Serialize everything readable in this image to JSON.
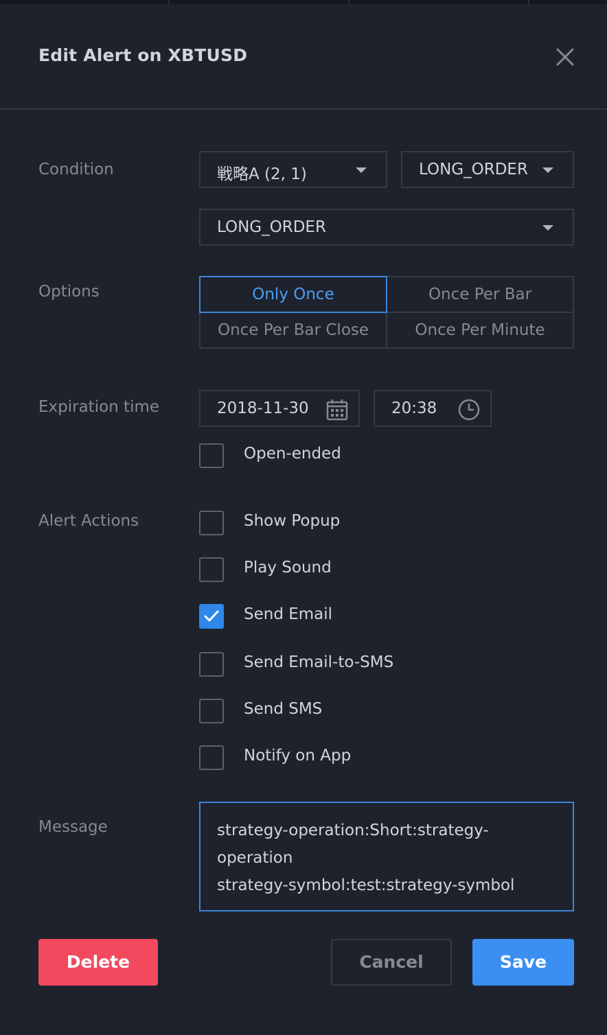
{
  "dialog": {
    "title": "Edit Alert on XBTUSD",
    "close_icon": "close-icon"
  },
  "condition": {
    "label": "Condition",
    "source": "戦略A (2, 1)",
    "field": "LONG_ORDER",
    "value": "LONG_ORDER"
  },
  "options": {
    "label": "Options",
    "items": [
      "Only Once",
      "Once Per Bar",
      "Once Per Bar Close",
      "Once Per Minute"
    ],
    "selected": "Only Once"
  },
  "expiration": {
    "label": "Expiration time",
    "date": "2018-11-30",
    "time": "20:38",
    "date_icon": "calendar-icon",
    "time_icon": "clock-icon",
    "open_ended_label": "Open-ended",
    "open_ended": false
  },
  "alert_actions": {
    "label": "Alert Actions",
    "items": [
      {
        "label": "Show Popup",
        "checked": false
      },
      {
        "label": "Play Sound",
        "checked": false
      },
      {
        "label": "Send Email",
        "checked": true
      },
      {
        "label": "Send Email-to-SMS",
        "checked": false
      },
      {
        "label": "Send SMS",
        "checked": false
      },
      {
        "label": "Notify on App",
        "checked": false
      }
    ]
  },
  "message": {
    "label": "Message",
    "value": "strategy-operation:Short:strategy-operation\nstrategy-symbol:test:strategy-symbol"
  },
  "buttons": {
    "delete": "Delete",
    "cancel": "Cancel",
    "save": "Save"
  },
  "colors": {
    "background": "#1e222d",
    "accent": "#3a8ff0",
    "danger": "#f2495e",
    "border": "#363a45"
  }
}
